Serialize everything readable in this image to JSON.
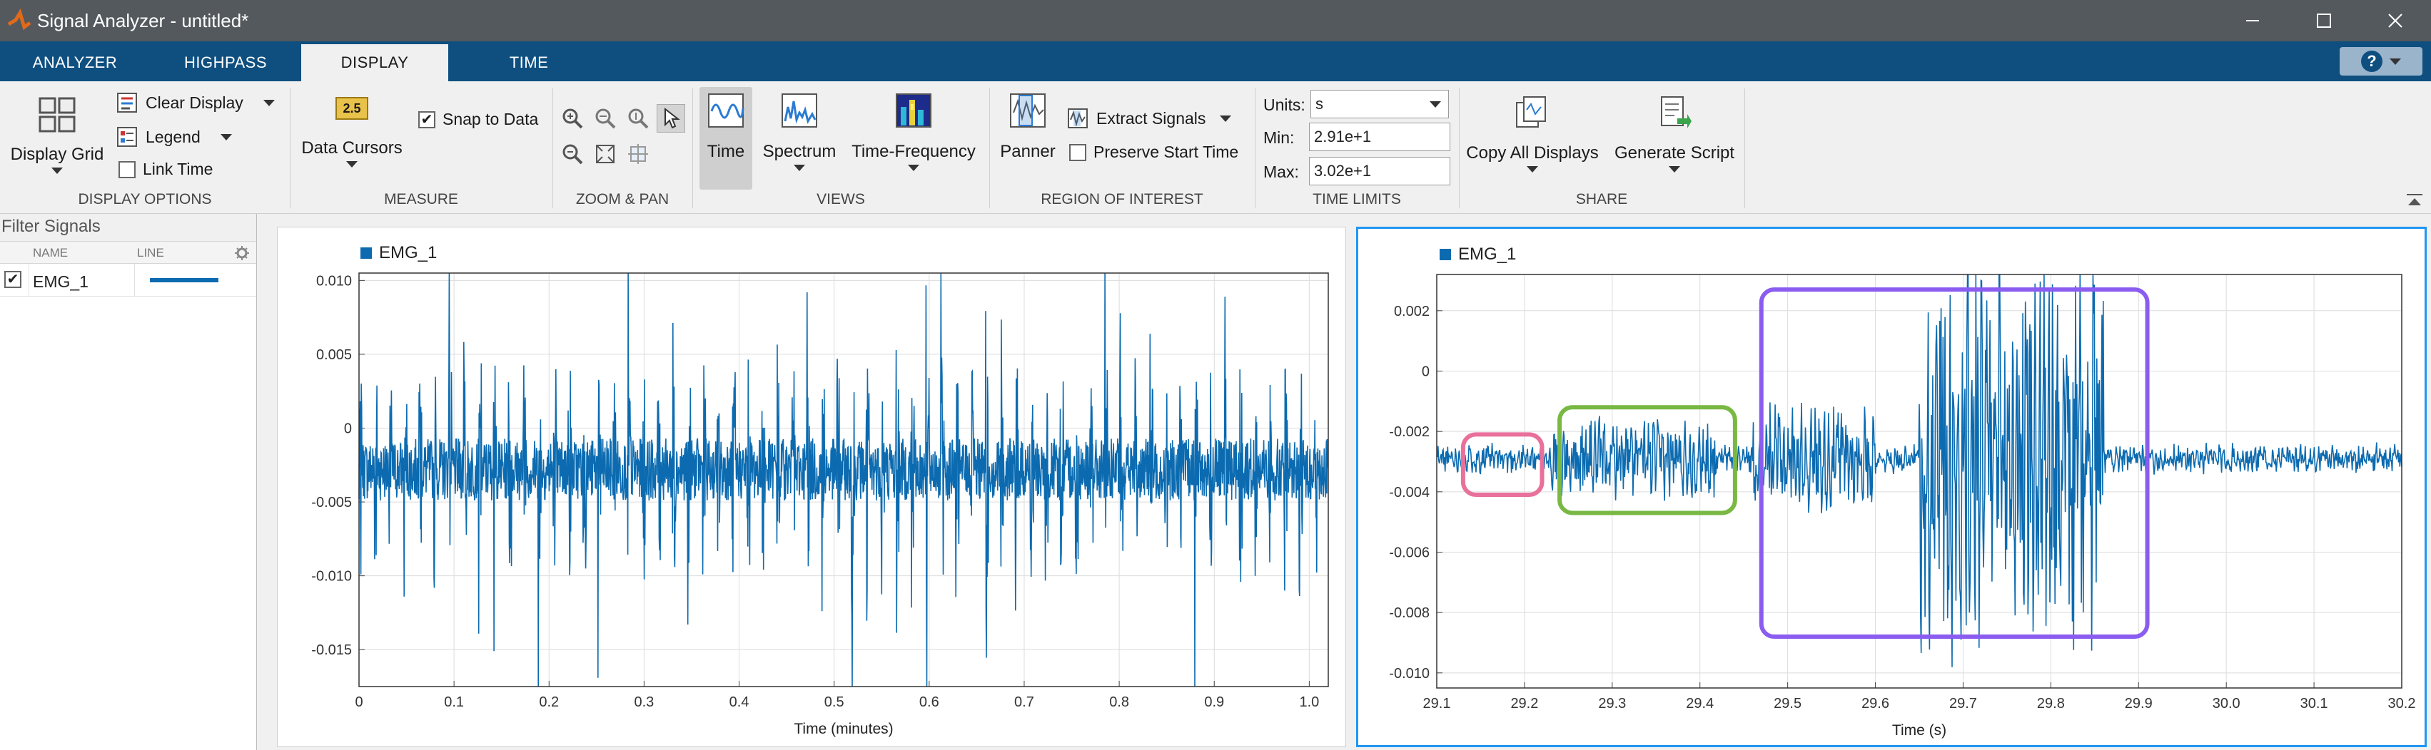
{
  "window": {
    "title": "Signal Analyzer - untitled*"
  },
  "tabs": [
    {
      "label": "ANALYZER",
      "active": false
    },
    {
      "label": "HIGHPASS",
      "active": false
    },
    {
      "label": "DISPLAY",
      "active": true
    },
    {
      "label": "TIME",
      "active": false
    }
  ],
  "toolstrip": {
    "display_options": {
      "title": "DISPLAY OPTIONS",
      "display_grid": "Display Grid",
      "clear_display": "Clear Display",
      "legend": "Legend",
      "link_time": "Link Time"
    },
    "measure": {
      "title": "MEASURE",
      "data_cursors": "Data Cursors",
      "cursor_icon_text": "2.5",
      "snap_to_data": "Snap to Data"
    },
    "zoom_pan": {
      "title": "ZOOM & PAN"
    },
    "views": {
      "title": "VIEWS",
      "time": "Time",
      "spectrum": "Spectrum",
      "time_frequency": "Time-Frequency"
    },
    "roi": {
      "title": "REGION OF INTEREST",
      "panner": "Panner",
      "extract_signals": "Extract Signals",
      "preserve_start_time": "Preserve Start Time"
    },
    "time_limits": {
      "title": "TIME LIMITS",
      "units_label": "Units:",
      "units_value": "s",
      "min_label": "Min:",
      "min_value": "2.91e+1",
      "max_label": "Max:",
      "max_value": "3.02e+1"
    },
    "share": {
      "title": "SHARE",
      "copy_all": "Copy All Displays",
      "generate_script": "Generate Script"
    }
  },
  "signals_panel": {
    "filter_placeholder": "Filter Signals",
    "col_name": "NAME",
    "col_line": "LINE",
    "rows": [
      {
        "name": "EMG_1",
        "checked": true,
        "color": "#0c6bb0"
      }
    ]
  },
  "colors": {
    "signal": "#0c6bb0",
    "accent": "#2196f3",
    "roi_pink": "#e8709a",
    "roi_green": "#78b843",
    "roi_purple": "#8a5cf0"
  },
  "chart_data": [
    {
      "type": "line",
      "series": [
        {
          "name": "EMG_1"
        }
      ],
      "xlabel": "Time (minutes)",
      "xlim": [
        0,
        1.02
      ],
      "ylim": [
        -0.0175,
        0.0105
      ],
      "x_ticks": [
        "0",
        "0.1",
        "0.2",
        "0.3",
        "0.4",
        "0.5",
        "0.6",
        "0.7",
        "0.8",
        "0.9",
        "1.0"
      ],
      "y_ticks": [
        "0.010",
        "0.005",
        "0",
        "-0.005",
        "-0.010",
        "-0.015"
      ],
      "grid": true,
      "legend": "top-left",
      "baseline": -0.0028,
      "description_values": {
        "spike_period_min": 0.0157,
        "max": 0.0089,
        "min": -0.0165
      }
    },
    {
      "type": "line",
      "series": [
        {
          "name": "EMG_1"
        }
      ],
      "xlabel": "Time (s)",
      "xlim": [
        29.1,
        30.2
      ],
      "ylim": [
        -0.0105,
        0.0032
      ],
      "x_ticks": [
        "29.1",
        "29.2",
        "29.3",
        "29.4",
        "29.5",
        "29.6",
        "29.7",
        "29.8",
        "29.9",
        "30.0",
        "30.1",
        "30.2"
      ],
      "y_ticks": [
        "0.002",
        "0",
        "-0.002",
        "-0.004",
        "-0.006",
        "-0.008",
        "-0.010"
      ],
      "grid": true,
      "legend": "top-left",
      "baseline": -0.0029,
      "bursts": [
        {
          "x_range": [
            29.23,
            29.42
          ],
          "amplitude": 0.0012
        },
        {
          "x_range": [
            29.46,
            29.6
          ],
          "amplitude": 0.0016
        },
        {
          "x_range": [
            29.65,
            29.86
          ],
          "amplitude": 0.006
        }
      ],
      "regions_of_interest": [
        {
          "x_range": [
            29.13,
            29.22
          ],
          "y_range": [
            -0.0041,
            -0.0021
          ],
          "color": "pink"
        },
        {
          "x_range": [
            29.24,
            29.44
          ],
          "y_range": [
            -0.0047,
            -0.0012
          ],
          "color": "green"
        },
        {
          "x_range": [
            29.47,
            29.91
          ],
          "y_range": [
            -0.0088,
            0.0027
          ],
          "color": "purple"
        }
      ]
    }
  ]
}
